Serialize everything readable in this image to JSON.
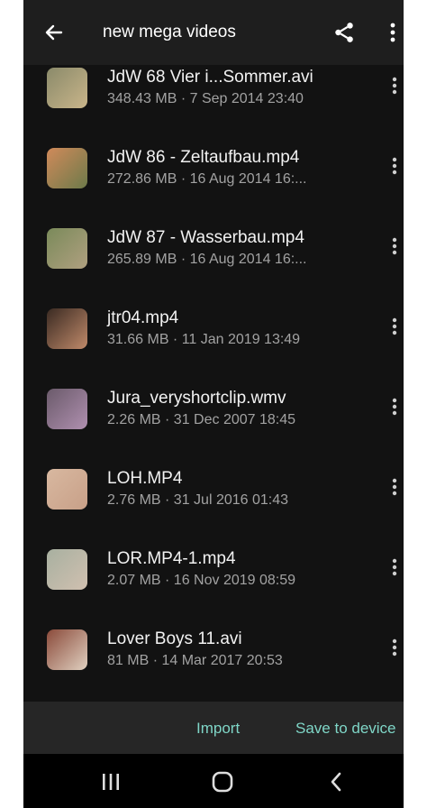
{
  "app_bar": {
    "title": "new mega videos",
    "back_icon": "arrow-left-icon",
    "share_icon": "share-icon",
    "overflow_icon": "more-vertical-icon"
  },
  "files": [
    {
      "name": "JdW 68 Vier i...Sommer.avi",
      "meta": "348.43 MB · 7 Sep 2014 23:40",
      "thumb_colors": [
        "#8a8a6a",
        "#c9b58a"
      ]
    },
    {
      "name": "JdW 86 - Zeltaufbau.mp4",
      "meta": "272.86 MB · 16 Aug 2014 16:...",
      "thumb_colors": [
        "#d08a5a",
        "#6d7a4a"
      ]
    },
    {
      "name": "JdW 87 - Wasserbau.mp4",
      "meta": "265.89 MB · 16 Aug 2014 16:...",
      "thumb_colors": [
        "#7a8a5a",
        "#b0a080"
      ]
    },
    {
      "name": "jtr04.mp4",
      "meta": "31.66 MB · 11 Jan 2019 13:49",
      "thumb_colors": [
        "#3a2a22",
        "#c08a6a"
      ]
    },
    {
      "name": "Jura_veryshortclip.wmv",
      "meta": "2.26 MB · 31 Dec 2007 18:45",
      "thumb_colors": [
        "#6a5a6a",
        "#b090b0"
      ]
    },
    {
      "name": "LOH.MP4",
      "meta": "2.76 MB · 31 Jul 2016 01:43",
      "thumb_colors": [
        "#d8b8a0",
        "#c8a088"
      ]
    },
    {
      "name": "LOR.MP4-1.mp4",
      "meta": "2.07 MB · 16 Nov 2019 08:59",
      "thumb_colors": [
        "#a8b0a0",
        "#d0c0b0"
      ]
    },
    {
      "name": "Lover Boys 11.avi",
      "meta": "81 MB · 14 Mar 2017 20:53",
      "thumb_colors": [
        "#8a4a3a",
        "#e0d0c0"
      ]
    }
  ],
  "row_menu_icon": "more-vertical-icon",
  "actions": {
    "import_label": "Import",
    "save_label": "Save to device",
    "accent_color": "#7fd6c7"
  },
  "system_nav": {
    "recents_icon": "recents-icon",
    "home_icon": "home-icon",
    "back_icon": "chevron-left-icon"
  }
}
